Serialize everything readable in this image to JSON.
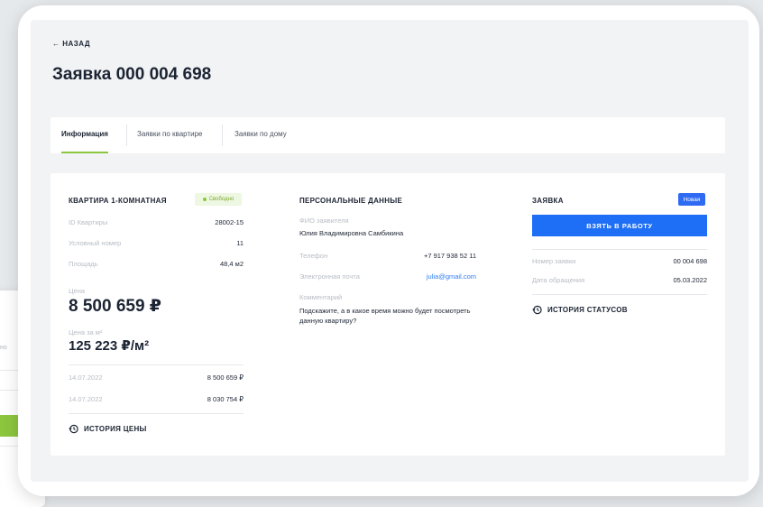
{
  "back_label": "← НАЗАД",
  "page_title": "Заявка 000 004 698",
  "tabs": [
    {
      "label": "Информация",
      "active": true
    },
    {
      "label": "Заявки по квартире",
      "active": false
    },
    {
      "label": "Заявки по дому",
      "active": false
    }
  ],
  "apartment": {
    "title": "КВАРТИРА 1-КОМНАТНАЯ",
    "status": "Свободно",
    "rows": [
      {
        "label": "ID Квартиры",
        "value": "28002-15"
      },
      {
        "label": "Условный номер",
        "value": "11"
      },
      {
        "label": "Площадь",
        "value": "48,4 м2"
      }
    ],
    "price_label": "Цена",
    "price": "8 500 659 ₽",
    "price_m2_label": "Цена за м²",
    "price_m2": "125 223 ₽/м²",
    "history": [
      {
        "date": "14.07.2022",
        "value": "8 500 659 ₽"
      },
      {
        "date": "14.07.2022",
        "value": "8 030 754 ₽"
      }
    ],
    "history_label": "ИСТОРИЯ ЦЕНЫ"
  },
  "personal": {
    "title": "ПЕРСОНАЛЬНЫЕ ДАННЫЕ",
    "fio_label": "ФИО заявителя",
    "fio": "Юлия Владимировна Самбикина",
    "phone_label": "Телефон",
    "phone": "+7 917 938 52 11",
    "email_label": "Электронная почта",
    "email": "julia@gmail.com",
    "comment_label": "Комментарий",
    "comment": "Подскажите, а в какое время можно будет посмотреть данную квартиру?"
  },
  "request": {
    "title": "ЗАЯВКА",
    "status_badge": "Новая",
    "button_label": "ВЗЯТЬ В РАБОТУ",
    "number_label": "Номер заявки",
    "number": "00 004 698",
    "date_label": "Дата обращения",
    "date": "05.03.2022",
    "history_label": "ИСТОРИЯ СТАТУСОВ"
  },
  "colors": {
    "accent_green": "#8cc63f",
    "accent_blue": "#1e6ff5"
  },
  "icons": {
    "history": "history-icon",
    "info": "info-icon",
    "back": "arrow-left-icon"
  }
}
